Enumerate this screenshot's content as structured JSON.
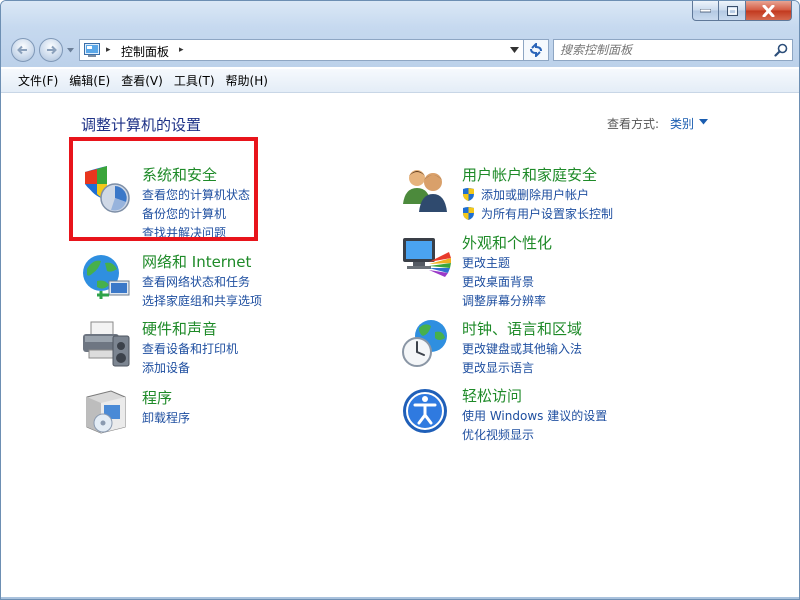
{
  "window": {
    "address": {
      "crumb": "控制面板",
      "sep": "▸"
    },
    "search": {
      "placeholder": "搜索控制面板"
    }
  },
  "menu": [
    "文件(F)",
    "编辑(E)",
    "查看(V)",
    "工具(T)",
    "帮助(H)"
  ],
  "page": {
    "title": "调整计算机的设置",
    "view_by_label": "查看方式:",
    "view_by_value": "类别"
  },
  "categories": {
    "system": {
      "title": "系统和安全",
      "links": [
        "查看您的计算机状态",
        "备份您的计算机",
        "查找并解决问题"
      ]
    },
    "network": {
      "title": "网络和 Internet",
      "links": [
        "查看网络状态和任务",
        "选择家庭组和共享选项"
      ]
    },
    "hardware": {
      "title": "硬件和声音",
      "links": [
        "查看设备和打印机",
        "添加设备"
      ]
    },
    "programs": {
      "title": "程序",
      "links": [
        "卸载程序"
      ]
    },
    "users": {
      "title": "用户帐户和家庭安全",
      "links": [
        "添加或删除用户帐户",
        "为所有用户设置家长控制"
      ]
    },
    "appearance": {
      "title": "外观和个性化",
      "links": [
        "更改主题",
        "更改桌面背景",
        "调整屏幕分辨率"
      ]
    },
    "clock": {
      "title": "时钟、语言和区域",
      "links": [
        "更改键盘或其他输入法",
        "更改显示语言"
      ]
    },
    "ease": {
      "title": "轻松访问",
      "links": [
        "使用 Windows 建议的设置",
        "优化视频显示"
      ]
    }
  },
  "colors": {
    "title_green": "#1e8a28",
    "link_blue": "#1f4fa0",
    "heading_blue": "#1e3287",
    "highlight_red": "#e8141b"
  }
}
